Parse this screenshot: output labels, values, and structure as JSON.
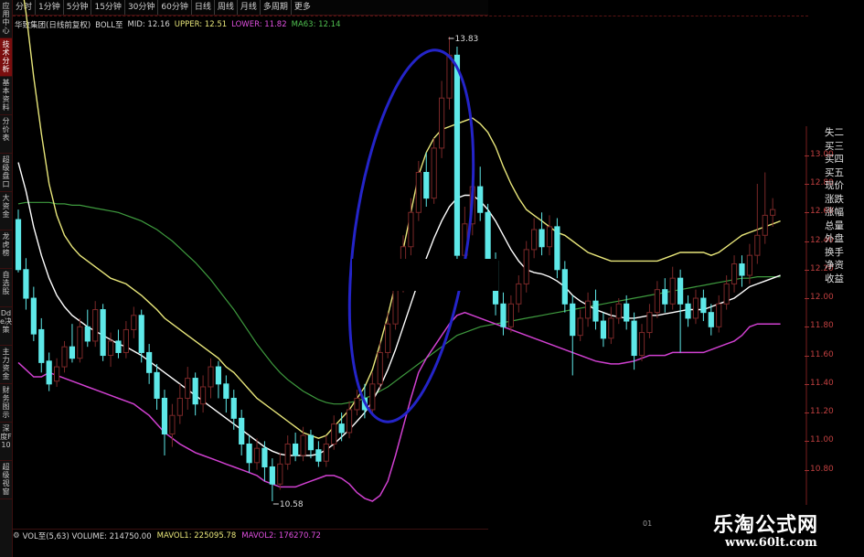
{
  "side_tabs": [
    "应用中心",
    "技术分析",
    "基本资料",
    "分价表",
    "超级盘口",
    "大资金",
    "龙虎榜",
    "自选股",
    "Dde决策",
    "主力资金",
    "财务图示",
    "深度F10",
    "超级视窗"
  ],
  "side_active": 1,
  "toolbar": {
    "periods": [
      "分时",
      "1分钟",
      "5分钟",
      "15分钟",
      "30分钟",
      "60分钟",
      "日线",
      "周线",
      "月线",
      "多周期",
      "更多"
    ]
  },
  "indicator": {
    "title": "华致集团(日线前复权)",
    "boll": "BOLL至",
    "mid": "MID: 12.16",
    "upper": "UPPER: 12.51",
    "lower": "LOWER: 11.82",
    "ma": "MA63: 12.14",
    "colors": {
      "mid": "#ffffff",
      "upper": "#e8e67a",
      "lower": "#d040d0",
      "ma63": "#3e9a3e",
      "up": "#5ee8e8",
      "down": "#7a2828"
    }
  },
  "volume_header": {
    "gear": "⚙",
    "vol": "VOL至(5,63) VOLUME: 214750.00",
    "mavol1": "MAVOL1: 225095.78",
    "mavol2": "MAVOL2: 176270.72"
  },
  "info_panel": [
    "失二",
    "买三",
    "买四",
    "买五",
    "现价",
    "涨跌",
    "涨幅",
    "总量",
    "外盘",
    "换手",
    "净资",
    "收益"
  ],
  "annotations": {
    "high": "13.83",
    "low": "10.58",
    "date_marker": "01"
  },
  "watermark": {
    "line1": "乐淘公式网",
    "line2": "www.60lt.com"
  },
  "chart_data": {
    "type": "candlestick",
    "ylim": [
      10.58,
      13.83
    ],
    "yticks": [
      "13.00",
      "12.80",
      "12.60",
      "12.40",
      "12.20",
      "12.00",
      "11.80",
      "11.60",
      "11.40",
      "11.20",
      "11.00",
      "10.80"
    ],
    "candles": [
      [
        12.55,
        12.2,
        12.62,
        12.18,
        1
      ],
      [
        12.2,
        12.0,
        12.28,
        11.92,
        1
      ],
      [
        12.0,
        11.75,
        12.08,
        11.7,
        1
      ],
      [
        11.78,
        11.55,
        11.86,
        11.48,
        1
      ],
      [
        11.56,
        11.4,
        11.62,
        11.35,
        1
      ],
      [
        11.42,
        11.52,
        11.58,
        11.38,
        0
      ],
      [
        11.52,
        11.66,
        11.7,
        11.48,
        0
      ],
      [
        11.66,
        11.58,
        11.82,
        11.55,
        1
      ],
      [
        11.58,
        11.8,
        11.86,
        11.55,
        0
      ],
      [
        11.8,
        11.7,
        11.92,
        11.66,
        1
      ],
      [
        11.7,
        11.92,
        11.98,
        11.66,
        0
      ],
      [
        11.92,
        11.6,
        11.96,
        11.56,
        1
      ],
      [
        11.6,
        11.7,
        11.76,
        11.52,
        0
      ],
      [
        11.7,
        11.62,
        11.78,
        11.58,
        1
      ],
      [
        11.62,
        11.78,
        11.84,
        11.58,
        0
      ],
      [
        11.78,
        11.88,
        11.94,
        11.72,
        0
      ],
      [
        11.88,
        11.62,
        11.92,
        11.55,
        1
      ],
      [
        11.62,
        11.48,
        11.68,
        11.4,
        1
      ],
      [
        11.48,
        11.3,
        11.54,
        11.22,
        1
      ],
      [
        11.3,
        11.05,
        11.36,
        10.9,
        1
      ],
      [
        11.05,
        11.18,
        11.26,
        10.96,
        0
      ],
      [
        11.18,
        11.3,
        11.4,
        11.12,
        0
      ],
      [
        11.3,
        11.44,
        11.52,
        11.22,
        0
      ],
      [
        11.44,
        11.26,
        11.48,
        11.18,
        1
      ],
      [
        11.26,
        11.38,
        11.46,
        11.2,
        0
      ],
      [
        11.38,
        11.52,
        11.58,
        11.3,
        0
      ],
      [
        11.52,
        11.4,
        11.56,
        11.3,
        1
      ],
      [
        11.4,
        11.3,
        11.46,
        11.2,
        1
      ],
      [
        11.3,
        11.16,
        11.36,
        11.08,
        1
      ],
      [
        11.16,
        10.98,
        11.22,
        10.9,
        1
      ],
      [
        10.98,
        10.85,
        11.04,
        10.78,
        1
      ],
      [
        10.85,
        10.95,
        11.02,
        10.8,
        0
      ],
      [
        10.95,
        10.82,
        11.0,
        10.72,
        1
      ],
      [
        10.82,
        10.7,
        10.88,
        10.58,
        1
      ],
      [
        10.7,
        10.84,
        10.92,
        10.66,
        0
      ],
      [
        10.84,
        10.98,
        11.04,
        10.8,
        0
      ],
      [
        10.98,
        10.9,
        11.06,
        10.86,
        1
      ],
      [
        10.9,
        11.04,
        11.1,
        10.86,
        0
      ],
      [
        11.04,
        10.94,
        11.08,
        10.88,
        1
      ],
      [
        10.94,
        10.86,
        11.0,
        10.82,
        1
      ],
      [
        10.86,
        10.98,
        11.04,
        10.82,
        0
      ],
      [
        10.98,
        11.12,
        11.18,
        10.94,
        0
      ],
      [
        11.12,
        11.06,
        11.2,
        11.0,
        1
      ],
      [
        11.06,
        11.22,
        11.28,
        11.02,
        0
      ],
      [
        11.22,
        11.3,
        11.36,
        11.18,
        0
      ],
      [
        11.3,
        11.22,
        11.4,
        11.16,
        1
      ],
      [
        11.22,
        11.4,
        11.48,
        11.18,
        0
      ],
      [
        11.4,
        11.62,
        11.7,
        11.36,
        0
      ],
      [
        11.62,
        11.82,
        11.9,
        11.58,
        0
      ],
      [
        11.82,
        12.08,
        12.16,
        11.78,
        0
      ],
      [
        12.08,
        12.36,
        12.44,
        12.04,
        0
      ],
      [
        12.36,
        12.6,
        12.7,
        12.3,
        0
      ],
      [
        12.6,
        12.88,
        12.96,
        12.54,
        0
      ],
      [
        12.88,
        12.7,
        13.02,
        12.64,
        1
      ],
      [
        12.7,
        13.05,
        13.12,
        12.66,
        0
      ],
      [
        13.05,
        13.4,
        13.52,
        12.98,
        0
      ],
      [
        13.4,
        13.7,
        13.83,
        13.32,
        0
      ],
      [
        13.7,
        12.3,
        13.76,
        12.22,
        1
      ],
      [
        12.3,
        12.52,
        12.64,
        12.2,
        0
      ],
      [
        12.52,
        12.78,
        12.86,
        12.44,
        0
      ],
      [
        12.78,
        12.6,
        12.92,
        12.54,
        1
      ],
      [
        12.6,
        12.26,
        12.66,
        12.2,
        1
      ],
      [
        12.26,
        11.96,
        12.32,
        11.88,
        1
      ],
      [
        11.96,
        11.8,
        12.04,
        11.74,
        1
      ],
      [
        11.8,
        11.96,
        12.02,
        11.76,
        0
      ],
      [
        11.96,
        12.1,
        12.16,
        11.9,
        0
      ],
      [
        12.1,
        12.34,
        12.4,
        12.04,
        0
      ],
      [
        12.34,
        12.48,
        12.56,
        12.28,
        0
      ],
      [
        12.48,
        12.36,
        12.6,
        12.3,
        1
      ],
      [
        12.36,
        12.5,
        12.58,
        12.3,
        0
      ],
      [
        12.5,
        12.2,
        12.56,
        12.14,
        1
      ],
      [
        12.2,
        11.96,
        12.26,
        11.9,
        1
      ],
      [
        11.96,
        11.74,
        12.02,
        11.46,
        1
      ],
      [
        11.74,
        11.86,
        11.92,
        11.7,
        0
      ],
      [
        11.86,
        11.98,
        12.04,
        11.8,
        0
      ],
      [
        11.98,
        11.84,
        12.06,
        11.78,
        1
      ],
      [
        11.84,
        11.72,
        11.9,
        11.66,
        1
      ],
      [
        11.72,
        11.86,
        11.94,
        11.68,
        0
      ],
      [
        11.86,
        11.96,
        12.0,
        11.82,
        0
      ],
      [
        11.96,
        11.84,
        12.02,
        11.78,
        1
      ],
      [
        11.84,
        11.6,
        11.9,
        11.5,
        1
      ],
      [
        11.6,
        11.76,
        11.82,
        11.56,
        0
      ],
      [
        11.76,
        11.9,
        11.96,
        11.72,
        0
      ],
      [
        11.9,
        12.06,
        12.12,
        11.86,
        0
      ],
      [
        12.06,
        11.96,
        12.14,
        11.9,
        1
      ],
      [
        11.96,
        12.14,
        12.22,
        11.92,
        0
      ],
      [
        12.14,
        11.96,
        12.2,
        11.62,
        1
      ],
      [
        11.96,
        11.86,
        12.02,
        11.8,
        1
      ],
      [
        11.86,
        12.0,
        12.06,
        11.82,
        0
      ],
      [
        12.0,
        11.9,
        12.06,
        11.84,
        1
      ],
      [
        11.9,
        11.8,
        11.96,
        11.74,
        1
      ],
      [
        11.8,
        11.96,
        12.02,
        11.76,
        0
      ],
      [
        11.96,
        12.1,
        12.16,
        11.92,
        0
      ],
      [
        12.1,
        12.24,
        12.3,
        12.04,
        0
      ],
      [
        12.24,
        12.16,
        12.3,
        12.08,
        1
      ],
      [
        12.16,
        12.3,
        12.38,
        12.1,
        0
      ],
      [
        12.3,
        12.44,
        12.8,
        12.24,
        0
      ],
      [
        12.44,
        12.58,
        12.88,
        12.38,
        0
      ],
      [
        12.58,
        12.62,
        12.7,
        12.5,
        0
      ]
    ],
    "upper": [
      14.35,
      14.0,
      13.55,
      13.15,
      12.8,
      12.58,
      12.44,
      12.36,
      12.3,
      12.26,
      12.22,
      12.18,
      12.14,
      12.12,
      12.1,
      12.06,
      12.02,
      11.97,
      11.92,
      11.86,
      11.82,
      11.78,
      11.74,
      11.7,
      11.66,
      11.62,
      11.58,
      11.52,
      11.48,
      11.42,
      11.36,
      11.3,
      11.26,
      11.22,
      11.18,
      11.14,
      11.1,
      11.06,
      11.04,
      11.02,
      11.04,
      11.1,
      11.16,
      11.22,
      11.3,
      11.38,
      11.5,
      11.68,
      11.88,
      12.1,
      12.34,
      12.6,
      12.86,
      13.02,
      13.12,
      13.18,
      13.2,
      13.22,
      13.24,
      13.26,
      13.22,
      13.16,
      13.06,
      12.92,
      12.8,
      12.7,
      12.62,
      12.58,
      12.54,
      12.5,
      12.46,
      12.44,
      12.4,
      12.36,
      12.32,
      12.3,
      12.28,
      12.26,
      12.26,
      12.26,
      12.26,
      12.26,
      12.26,
      12.26,
      12.28,
      12.3,
      12.32,
      12.32,
      12.32,
      12.32,
      12.3,
      12.32,
      12.36,
      12.4,
      12.44,
      12.46,
      12.48,
      12.5,
      12.52,
      12.54
    ],
    "mid": [
      12.95,
      12.75,
      12.5,
      12.3,
      12.14,
      12.02,
      11.94,
      11.88,
      11.84,
      11.8,
      11.77,
      11.74,
      11.71,
      11.68,
      11.66,
      11.63,
      11.6,
      11.56,
      11.52,
      11.48,
      11.44,
      11.4,
      11.36,
      11.32,
      11.28,
      11.24,
      11.2,
      11.16,
      11.12,
      11.08,
      11.04,
      11.0,
      10.96,
      10.93,
      10.91,
      10.9,
      10.9,
      10.9,
      10.9,
      10.91,
      10.94,
      10.98,
      11.03,
      11.08,
      11.14,
      11.2,
      11.28,
      11.38,
      11.5,
      11.64,
      11.8,
      11.96,
      12.12,
      12.28,
      12.42,
      12.54,
      12.64,
      12.7,
      12.72,
      12.72,
      12.68,
      12.62,
      12.54,
      12.44,
      12.34,
      12.26,
      12.2,
      12.18,
      12.17,
      12.15,
      12.12,
      12.08,
      12.02,
      11.98,
      11.95,
      11.92,
      11.9,
      11.88,
      11.87,
      11.86,
      11.86,
      11.87,
      11.88,
      11.88,
      11.89,
      11.9,
      11.91,
      11.92,
      11.92,
      11.92,
      11.94,
      11.96,
      11.98,
      12.0,
      12.04,
      12.08,
      12.1,
      12.12,
      12.14,
      12.16
    ],
    "lower": [
      11.55,
      11.5,
      11.45,
      11.45,
      11.48,
      11.46,
      11.44,
      11.42,
      11.4,
      11.38,
      11.36,
      11.34,
      11.32,
      11.3,
      11.28,
      11.26,
      11.22,
      11.18,
      11.12,
      11.06,
      11.02,
      10.98,
      10.95,
      10.92,
      10.9,
      10.88,
      10.86,
      10.84,
      10.82,
      10.8,
      10.78,
      10.76,
      10.72,
      10.7,
      10.68,
      10.68,
      10.68,
      10.7,
      10.72,
      10.74,
      10.76,
      10.76,
      10.74,
      10.7,
      10.64,
      10.6,
      10.58,
      10.62,
      10.72,
      10.9,
      11.1,
      11.3,
      11.48,
      11.58,
      11.66,
      11.74,
      11.82,
      11.88,
      11.9,
      11.88,
      11.86,
      11.84,
      11.82,
      11.8,
      11.78,
      11.76,
      11.74,
      11.72,
      11.7,
      11.68,
      11.66,
      11.64,
      11.62,
      11.6,
      11.58,
      11.56,
      11.55,
      11.54,
      11.54,
      11.55,
      11.56,
      11.58,
      11.6,
      11.6,
      11.6,
      11.62,
      11.62,
      11.62,
      11.62,
      11.62,
      11.64,
      11.66,
      11.68,
      11.7,
      11.74,
      11.8,
      11.82,
      11.82,
      11.82,
      11.82
    ],
    "ma63": [
      12.66,
      12.67,
      12.67,
      12.67,
      12.67,
      12.66,
      12.66,
      12.65,
      12.65,
      12.64,
      12.63,
      12.62,
      12.61,
      12.6,
      12.58,
      12.56,
      12.54,
      12.51,
      12.48,
      12.44,
      12.4,
      12.35,
      12.3,
      12.25,
      12.19,
      12.13,
      12.06,
      11.99,
      11.92,
      11.84,
      11.76,
      11.68,
      11.61,
      11.54,
      11.48,
      11.43,
      11.39,
      11.35,
      11.32,
      11.29,
      11.27,
      11.26,
      11.26,
      11.27,
      11.28,
      11.3,
      11.32,
      11.35,
      11.38,
      11.42,
      11.46,
      11.5,
      11.54,
      11.58,
      11.62,
      11.66,
      11.7,
      11.74,
      11.76,
      11.78,
      11.8,
      11.81,
      11.82,
      11.83,
      11.84,
      11.85,
      11.86,
      11.87,
      11.88,
      11.89,
      11.9,
      11.91,
      11.92,
      11.93,
      11.94,
      11.95,
      11.96,
      11.97,
      11.98,
      11.99,
      12.0,
      12.01,
      12.02,
      12.03,
      12.04,
      12.05,
      12.06,
      12.07,
      12.08,
      12.09,
      12.1,
      12.11,
      12.12,
      12.13,
      12.14,
      12.14,
      12.15,
      12.15,
      12.15,
      12.15
    ]
  }
}
